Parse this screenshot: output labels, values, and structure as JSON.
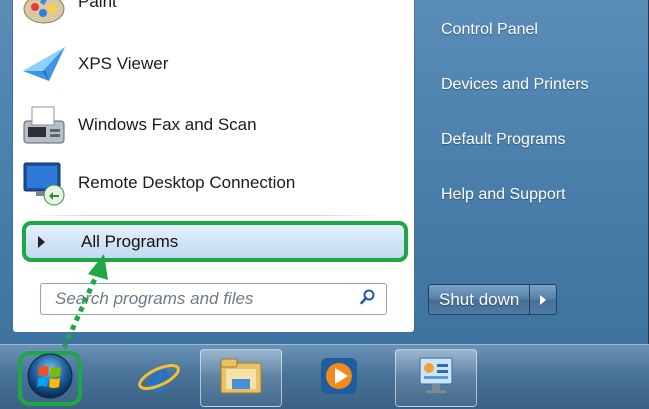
{
  "programs": [
    {
      "label": "Paint",
      "icon": "paint-icon"
    },
    {
      "label": "XPS Viewer",
      "icon": "xps-viewer-icon"
    },
    {
      "label": "Windows Fax and Scan",
      "icon": "fax-scan-icon"
    },
    {
      "label": "Remote Desktop Connection",
      "icon": "remote-desktop-icon"
    }
  ],
  "all_programs": {
    "label": "All Programs",
    "highlight_color": "#1fa645"
  },
  "search": {
    "placeholder": "Search programs and files",
    "value": ""
  },
  "right_menu": [
    {
      "label": "Control Panel"
    },
    {
      "label": "Devices and Printers"
    },
    {
      "label": "Default Programs"
    },
    {
      "label": "Help and Support"
    }
  ],
  "shutdown": {
    "label": "Shut down"
  },
  "taskbar": {
    "items": [
      {
        "icon": "start-orb-icon"
      },
      {
        "icon": "internet-explorer-icon"
      },
      {
        "icon": "windows-explorer-icon"
      },
      {
        "icon": "media-player-icon"
      },
      {
        "icon": "control-panel-icon"
      }
    ]
  },
  "colors": {
    "annotation": "#1fa645",
    "accent": "#4a7fac"
  }
}
